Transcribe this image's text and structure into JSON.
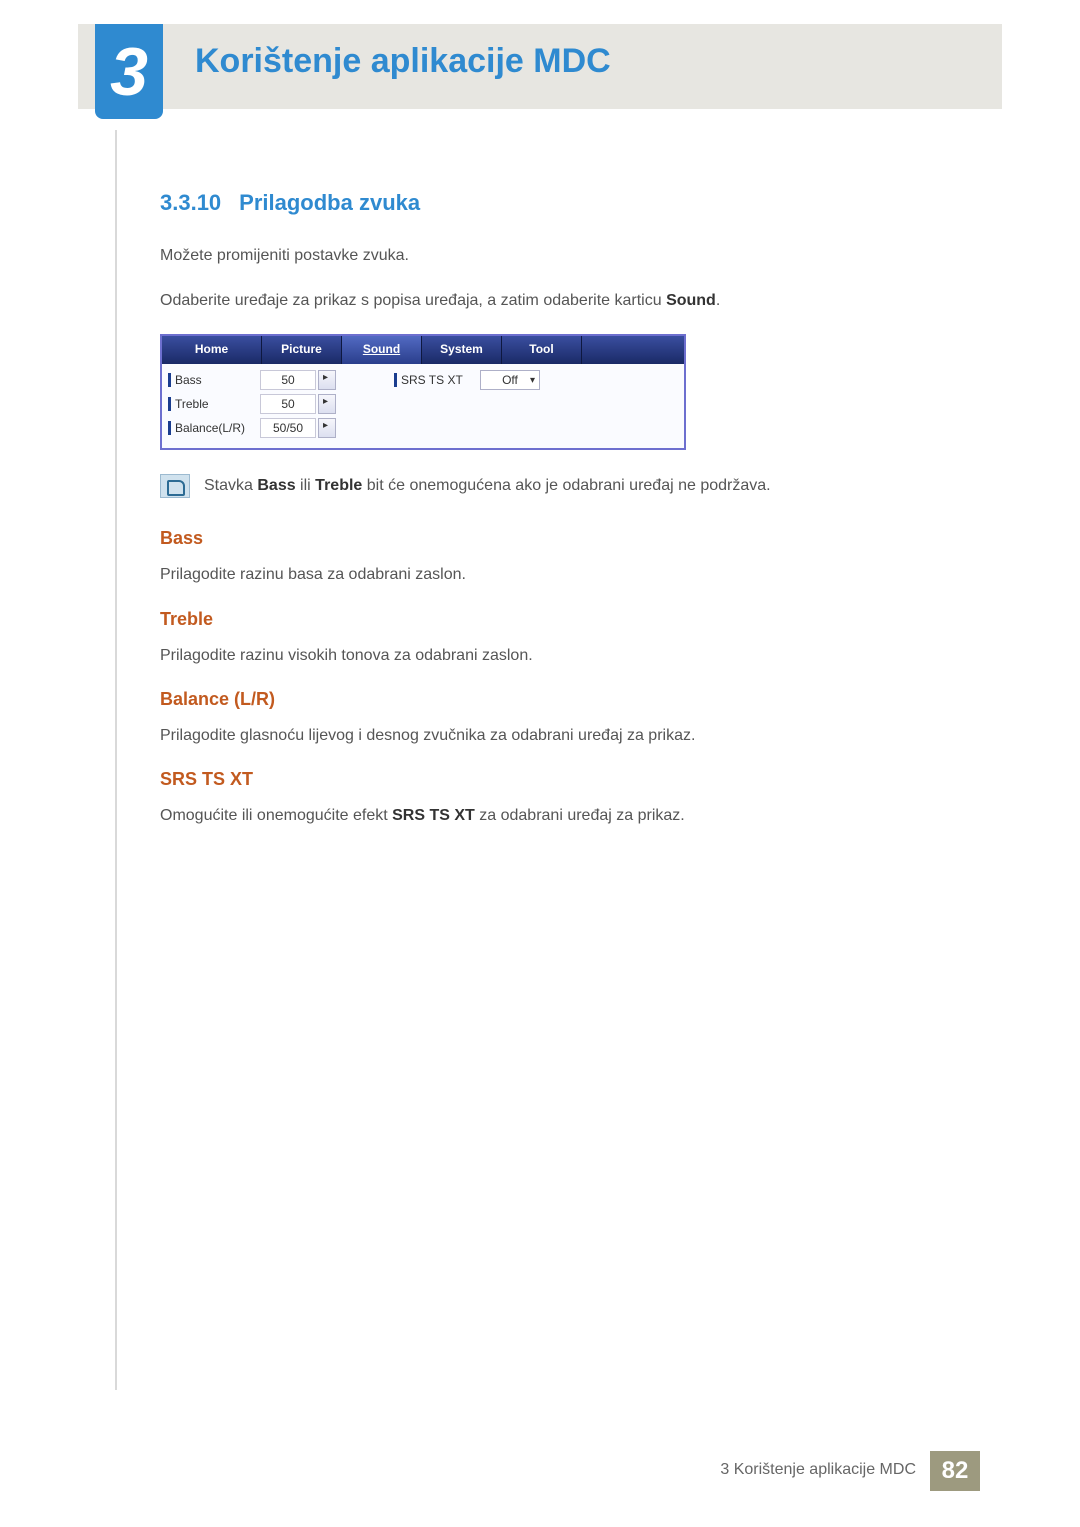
{
  "chapter": {
    "number": "3",
    "title": "Korištenje aplikacije MDC"
  },
  "section": {
    "number": "3.3.10",
    "title": "Prilagodba zvuka"
  },
  "intro": {
    "p1": "Možete promijeniti postavke zvuka.",
    "p2_a": "Odaberite uređaje za prikaz s popisa uređaja, a zatim odaberite karticu ",
    "p2_b": "Sound",
    "p2_c": "."
  },
  "ui": {
    "tabs": {
      "home": "Home",
      "picture": "Picture",
      "sound": "Sound",
      "system": "System",
      "tool": "Tool"
    },
    "rows": {
      "bass": {
        "label": "Bass",
        "value": "50"
      },
      "treble": {
        "label": "Treble",
        "value": "50"
      },
      "balance": {
        "label": "Balance(L/R)",
        "value": "50/50"
      },
      "srs": {
        "label": "SRS TS XT",
        "value": "Off"
      }
    }
  },
  "note": {
    "a": "Stavka ",
    "b1": "Bass",
    "mid": " ili ",
    "b2": "Treble",
    "c": " bit će onemogućena ako je odabrani uređaj ne podržava."
  },
  "subs": {
    "bass": {
      "h": "Bass",
      "p": "Prilagodite razinu basa za odabrani zaslon."
    },
    "treble": {
      "h": "Treble",
      "p": "Prilagodite razinu visokih tonova za odabrani zaslon."
    },
    "balance": {
      "h": "Balance (L/R)",
      "p": "Prilagodite glasnoću lijevog i desnog zvučnika za odabrani uređaj za prikaz."
    },
    "srs": {
      "h": "SRS TS XT",
      "p_a": "Omogućite ili onemogućite efekt ",
      "p_b": "SRS TS XT",
      "p_c": " za odabrani uređaj za prikaz."
    }
  },
  "footer": {
    "text": "3 Korištenje aplikacije MDC",
    "page": "82"
  }
}
